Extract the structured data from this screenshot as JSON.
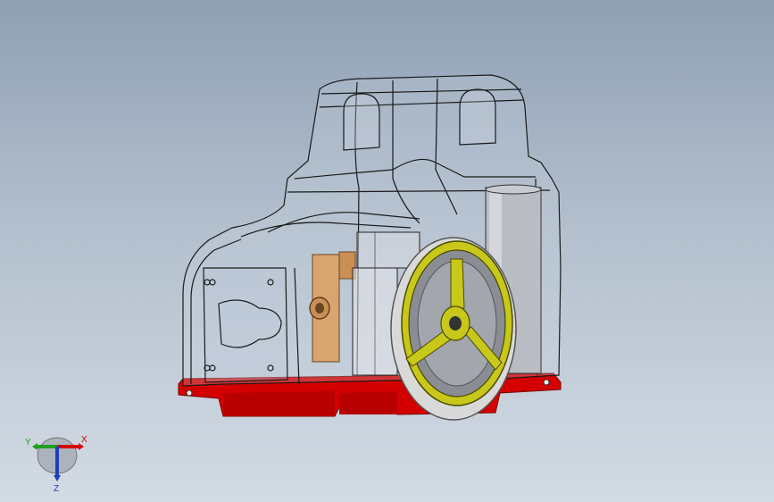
{
  "viewport": {
    "background_top": "#8fa0b4",
    "background_bottom": "#d3dbe4"
  },
  "model": {
    "housing_edge_color": "#1a1a1a",
    "base_color": "#d40000",
    "handwheel_color": "#c8c81a",
    "handwheel_rim_color": "#d9d9d9",
    "motor_color": "#b9bcc2",
    "bracket_color": "#d9a56e"
  },
  "triad": {
    "x_label": "X",
    "y_label": "Y",
    "z_label": "Z",
    "x_color": "#d40000",
    "y_color": "#1f9e1f",
    "z_color": "#1f3fbf"
  }
}
